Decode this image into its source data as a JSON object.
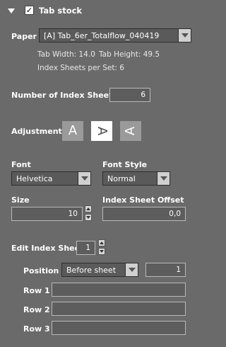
{
  "header": {
    "title": "Tab stock",
    "checked": "✓"
  },
  "paper": {
    "label": "Paper",
    "value": "[A] Tab_6er_Totalflow_040419",
    "tab_width": "Tab Width: 14.0",
    "tab_height": "Tab Height: 49.5",
    "index_sheets_per_set": "Index Sheets per Set: 6"
  },
  "number_of_index_sheets": {
    "label": "Number of Index Sheets",
    "value": "6"
  },
  "adjustment": {
    "label": "Adjustment",
    "options": [
      "A",
      "A",
      "A"
    ],
    "selected_index": 1
  },
  "font": {
    "label": "Font",
    "value": "Helvetica"
  },
  "font_style": {
    "label": "Font Style",
    "value": "Normal"
  },
  "size": {
    "label": "Size",
    "value": "10"
  },
  "index_sheet_offset": {
    "label": "Index Sheet Offset",
    "value": "0,0"
  },
  "edit_index_sheet": {
    "label": "Edit Index Sheet",
    "value": "1"
  },
  "position": {
    "label": "Position",
    "value": "Before sheet",
    "number": "1"
  },
  "rows": [
    {
      "label": "Row 1",
      "value": ""
    },
    {
      "label": "Row 2",
      "value": ""
    },
    {
      "label": "Row 3",
      "value": ""
    }
  ]
}
